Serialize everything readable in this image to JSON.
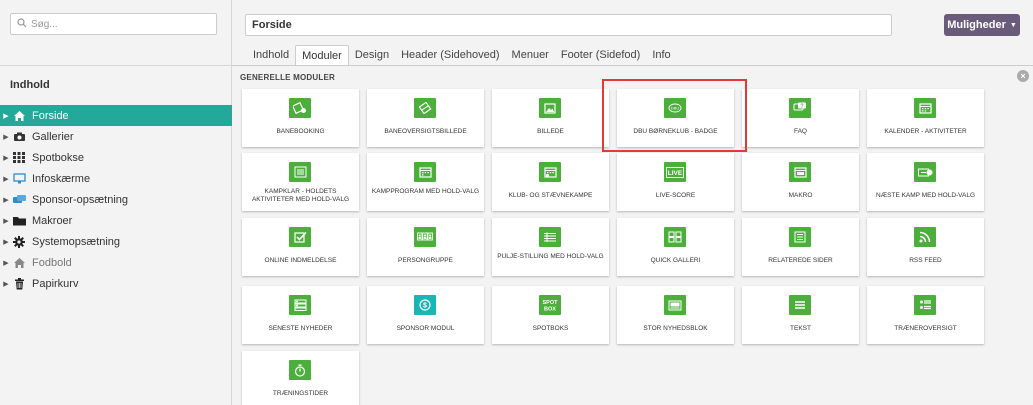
{
  "search": {
    "placeholder": "Søg..."
  },
  "sidebar": {
    "title": "Indhold",
    "items": [
      {
        "label": "Forside",
        "icon": "home-icon",
        "active": true
      },
      {
        "label": "Gallerier",
        "icon": "camera-icon"
      },
      {
        "label": "Spotbokse",
        "icon": "grid-icon"
      },
      {
        "label": "Infoskærme",
        "icon": "monitor-icon"
      },
      {
        "label": "Sponsor-opsætning",
        "icon": "sponsor-icon"
      },
      {
        "label": "Makroer",
        "icon": "folder-icon"
      },
      {
        "label": "Systemopsætning",
        "icon": "gear-icon"
      },
      {
        "label": "Fodbold",
        "icon": "home-icon",
        "muted": true
      },
      {
        "label": "Papirkurv",
        "icon": "trash-icon"
      }
    ]
  },
  "header": {
    "title_value": "Forside",
    "options_label": "Muligheder",
    "tabs": [
      "Indhold",
      "Moduler",
      "Design",
      "Header (Sidehoved)",
      "Menuer",
      "Footer (Sidefod)",
      "Info"
    ],
    "active_tab": "Moduler"
  },
  "main": {
    "section_title": "GENERELLE MODULER",
    "modules": [
      {
        "label": "BANEBOOKING",
        "icon": "banebooking-icon"
      },
      {
        "label": "BANEOVERSIGTSBILLEDE",
        "icon": "baneoversigt-icon"
      },
      {
        "label": "BILLEDE",
        "icon": "image-icon"
      },
      {
        "label": "DBU BØRNEKLUB - BADGE",
        "icon": "dbu-badge-icon"
      },
      {
        "label": "FAQ",
        "icon": "faq-icon"
      },
      {
        "label": "KALENDER - AKTIVITETER",
        "icon": "calendar-icon"
      },
      {
        "label": "KAMPKLAR - HOLDETS AKTIVITETER MED HOLD-VALG",
        "icon": "kampklar-icon"
      },
      {
        "label": "KAMPPROGRAM MED HOLD-VALG",
        "icon": "calendar-icon"
      },
      {
        "label": "KLUB- OG STÆVNEKAMPE",
        "icon": "calendar-icon"
      },
      {
        "label": "LIVE-SCORE",
        "icon": "live-icon"
      },
      {
        "label": "MAKRO",
        "icon": "makro-icon"
      },
      {
        "label": "NÆSTE KAMP MED HOLD-VALG",
        "icon": "next-match-icon"
      },
      {
        "label": "ONLINE INDMELDELSE",
        "icon": "checkbox-icon"
      },
      {
        "label": "PERSONGRUPPE",
        "icon": "people-icon"
      },
      {
        "label": "PULJE-STILLING MED HOLD-VALG",
        "icon": "table-icon"
      },
      {
        "label": "QUICK GALLERI",
        "icon": "gallery-icon"
      },
      {
        "label": "RELATEREDE SIDER",
        "icon": "list-icon"
      },
      {
        "label": "RSS FEED",
        "icon": "rss-icon"
      },
      {
        "label": "SENESTE NYHEDER",
        "icon": "news-icon"
      },
      {
        "label": "SPONSOR MODUL",
        "icon": "dollar-icon"
      },
      {
        "label": "SPOTBOKS",
        "icon": "spotbox-icon",
        "icon_text": "SPOT BOX"
      },
      {
        "label": "STOR NYHEDSBLOK",
        "icon": "bignews-icon"
      },
      {
        "label": "TEKST",
        "icon": "text-icon"
      },
      {
        "label": "TRÆNEROVERSIGT",
        "icon": "coaches-icon"
      },
      {
        "label": "TRÆNINGSTIDER",
        "icon": "stopwatch-icon"
      }
    ]
  },
  "colors": {
    "active": "#23a89a",
    "module_green": "#4caf3c",
    "module_teal": "#1ab5b5",
    "options_button": "#6b5b7b",
    "highlight": "#e53935"
  }
}
